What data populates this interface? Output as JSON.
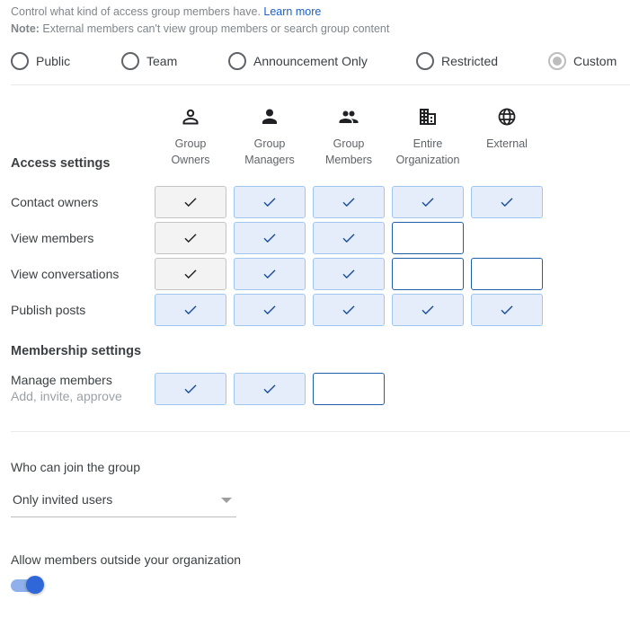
{
  "intro": {
    "text": "Control what kind of access group members have. ",
    "learn_more": "Learn more",
    "note_label": "Note:",
    "note_text": " External members can't view group members or search group content"
  },
  "access_type": {
    "options": [
      {
        "label": "Public",
        "selected": false
      },
      {
        "label": "Team",
        "selected": false
      },
      {
        "label": "Announcement Only",
        "selected": false
      },
      {
        "label": "Restricted",
        "selected": false
      },
      {
        "label": "Custom",
        "selected": true
      }
    ]
  },
  "columns": [
    {
      "icon": "person-outline-icon",
      "line1": "Group",
      "line2": "Owners"
    },
    {
      "icon": "person-icon",
      "line1": "Group",
      "line2": "Managers"
    },
    {
      "icon": "people-icon",
      "line1": "Group",
      "line2": "Members"
    },
    {
      "icon": "domain-icon",
      "line1": "Entire",
      "line2": "Organization"
    },
    {
      "icon": "globe-icon",
      "line1": "External",
      "line2": ""
    }
  ],
  "access_settings": {
    "title": "Access settings",
    "rows": [
      {
        "label": "Contact owners",
        "cells": [
          "locked",
          "on",
          "on",
          "on",
          "on"
        ]
      },
      {
        "label": "View members",
        "cells": [
          "locked",
          "on",
          "on",
          "off",
          "none"
        ]
      },
      {
        "label": "View conversations",
        "cells": [
          "locked",
          "on",
          "on",
          "off",
          "off"
        ]
      },
      {
        "label": "Publish posts",
        "cells": [
          "on",
          "on",
          "on",
          "on",
          "on"
        ]
      }
    ]
  },
  "membership_settings": {
    "title": "Membership settings",
    "rows": [
      {
        "label": "Manage members",
        "sublabel": "Add, invite, approve",
        "cells": [
          "on",
          "on",
          "off"
        ]
      }
    ]
  },
  "join": {
    "label": "Who can join the group",
    "value": "Only invited users"
  },
  "external_members": {
    "label": "Allow members outside your organization",
    "enabled": true
  },
  "colors": {
    "accent": "#2f66d8",
    "link": "#1a5fd0",
    "check_on": "#1b4f9c",
    "check_locked": "#202124"
  }
}
